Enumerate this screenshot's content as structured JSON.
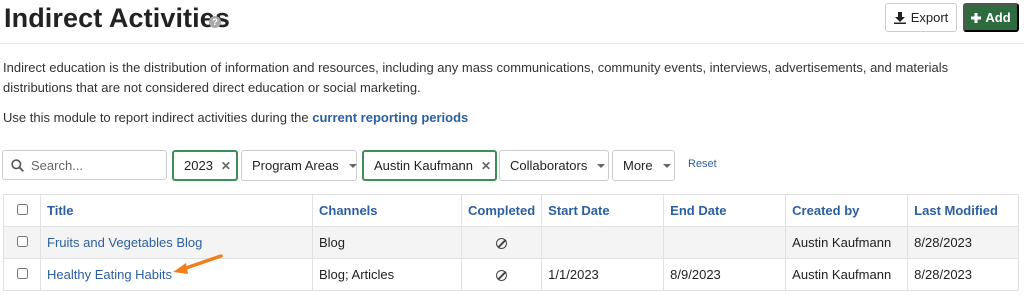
{
  "header": {
    "title": "Indirect Activities",
    "help_icon": "question-circle-icon",
    "export_label": "Export",
    "add_label": "Add"
  },
  "description": {
    "paragraph1": "Indirect education is the distribution of information and resources, including any mass communications, community events, interviews, advertisements, and materials distributions that are not considered direct education or social marketing.",
    "paragraph2_prefix": "Use this module to report indirect activities during the ",
    "paragraph2_link": "current reporting periods"
  },
  "filters": {
    "search_placeholder": "Search...",
    "year": "2023",
    "program_areas": "Program Areas",
    "person": "Austin Kaufmann",
    "collaborators": "Collaborators",
    "more": "More",
    "reset": "Reset"
  },
  "table": {
    "headers": {
      "title": "Title",
      "channels": "Channels",
      "completed": "Completed",
      "start_date": "Start Date",
      "end_date": "End Date",
      "created_by": "Created by",
      "last_modified": "Last Modified"
    },
    "rows": [
      {
        "title": "Fruits and Vegetables Blog",
        "channels": "Blog",
        "completed_icon": "not-completed-icon",
        "start_date": "",
        "end_date": "",
        "created_by": "Austin Kaufmann",
        "last_modified": "8/28/2023"
      },
      {
        "title": "Healthy Eating Habits",
        "channels": "Blog; Articles",
        "completed_icon": "not-completed-icon",
        "start_date": "1/1/2023",
        "end_date": "8/9/2023",
        "created_by": "Austin Kaufmann",
        "last_modified": "8/28/2023"
      }
    ]
  },
  "colors": {
    "link": "#2c5fa0",
    "add_button": "#2e6b3f",
    "active_filter_border": "#3e8e57",
    "annotation_arrow": "#f07f1e"
  }
}
